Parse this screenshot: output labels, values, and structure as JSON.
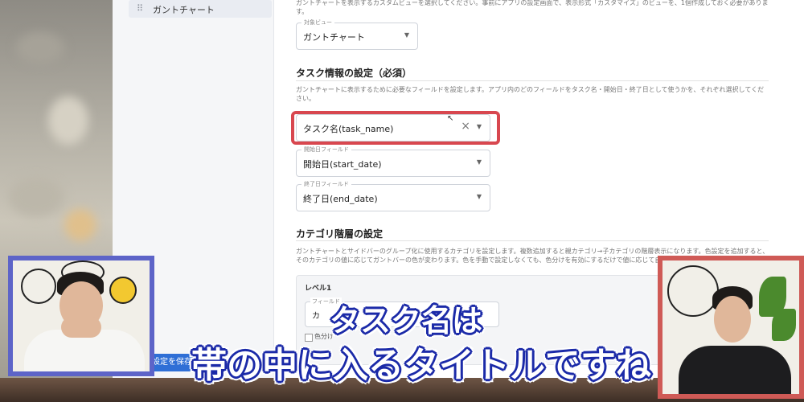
{
  "sidebar": {
    "item_label": "ガントチャート",
    "item_grip": "⠿",
    "save_label": "設定を保存"
  },
  "top_desc": "ガントチャートを表示するカスタムビューを選択してください。事前にアプリの設定画面で、表示形式「カスタマイズ」のビューを、1個作成しておく必要があります。",
  "view_select": {
    "legend": "対象ビュー",
    "value": "ガントチャート"
  },
  "task_section": {
    "title": "タスク情報の設定（必須）",
    "desc": "ガントチャートに表示するために必要なフィールドを設定します。アプリ内のどのフィールドをタスク名・開始日・終了日として使うかを、それぞれ選択してください。",
    "task_name": {
      "value": "タスク名(task_name)",
      "clear": "×"
    },
    "start": {
      "legend": "開始日フィールド",
      "value": "開始日(start_date)"
    },
    "end": {
      "legend": "終了日フィールド",
      "value": "終了日(end_date)"
    }
  },
  "category_section": {
    "title": "カテゴリ階層の設定",
    "desc": "ガントチャートとサイドバーのグループ化に使用するカテゴリを設定します。複数追加すると親カテゴリ→子カテゴリの階層表示になります。色設定を追加すると、そのカテゴリの値に応じてガントバーの色が変わります。色を手動で設定しなくても、色分けを有効にするだけで値に応じて自動で色分けされます。",
    "level_label": "レベル1",
    "field_legend": "フィールド",
    "field_value": "カ",
    "color_checkbox": "色分け"
  },
  "caret": "▼",
  "captions": {
    "line1": "タスク名は",
    "line2": "帯の中に入るタイトルですね"
  },
  "colors": {
    "highlight": "#d8474f",
    "cam_left_border": "#5d64c8",
    "cam_right_border": "#cf5a56",
    "caption_outline": "#1b2aa8",
    "save_button": "#2f6fd6"
  }
}
